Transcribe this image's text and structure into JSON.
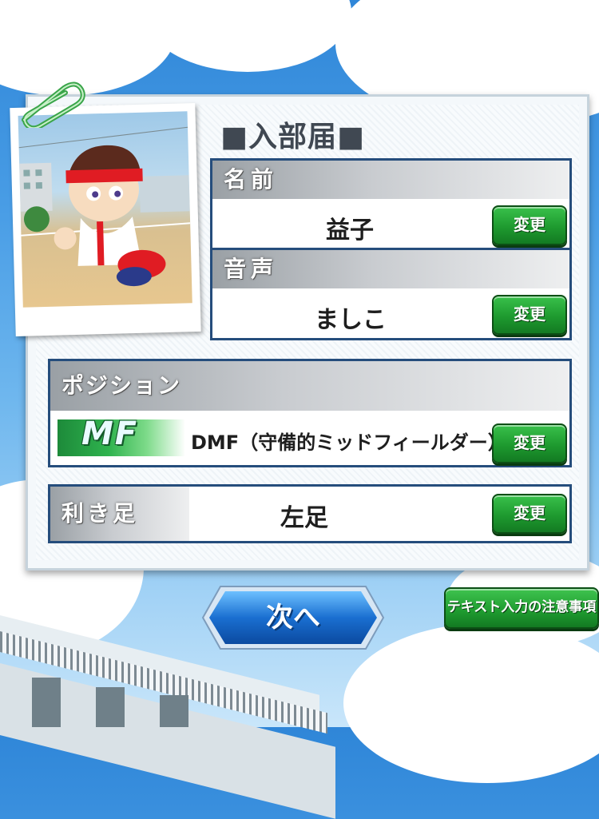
{
  "form": {
    "title": "■入部届■",
    "name_section": {
      "label": "名前",
      "value": "益子",
      "change_label": "変更"
    },
    "voice_section": {
      "label": "音声",
      "value": "ましこ",
      "change_label": "変更"
    },
    "position_section": {
      "label": "ポジション",
      "badge": "MF",
      "value": "DMF（守備的ミッドフィールダー）",
      "change_label": "変更"
    },
    "foot_section": {
      "label": "利き足",
      "value": "左足",
      "change_label": "変更"
    }
  },
  "buttons": {
    "next_label": "次へ",
    "notice_label": "テキスト入力の注意事項"
  },
  "colors": {
    "panel_border": "#254d7c",
    "change_button": "#1e9a2f",
    "next_button": "#1a6fd1",
    "badge_green": "#2fb34e"
  },
  "icons": [
    "paperclip-icon",
    "character-portrait"
  ]
}
